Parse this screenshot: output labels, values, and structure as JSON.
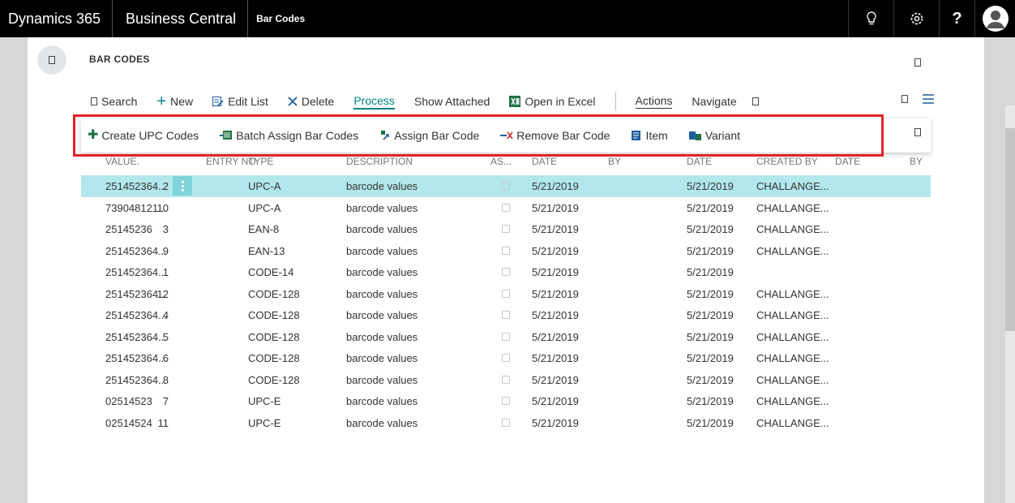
{
  "topbar": {
    "app_name": "Dynamics 365",
    "product_name": "Business Central",
    "page_name": "Bar Codes",
    "icons": [
      "lightbulb-icon",
      "gear-icon",
      "help-icon",
      "user-avatar-icon"
    ],
    "help_label": "?"
  },
  "page": {
    "title": "BAR CODES"
  },
  "actionbar": {
    "search": "Search",
    "new": "New",
    "edit_list": "Edit List",
    "delete": "Delete",
    "process": "Process",
    "show_attached": "Show Attached",
    "open_in_excel": "Open in Excel",
    "actions": "Actions",
    "navigate": "Navigate"
  },
  "submenu": {
    "create_upc": "Create UPC Codes",
    "batch_assign": "Batch Assign Bar Codes",
    "assign": "Assign Bar Code",
    "remove": "Remove Bar Code",
    "item": "Item",
    "variant": "Variant"
  },
  "columns": {
    "value": "VALUE.",
    "entry_no": "ENTRY NO",
    "type": "TYPE",
    "description": "DESCRIPTION",
    "as": "AS...",
    "date": "DATE",
    "by": "BY",
    "date2": "DATE",
    "created_by": "CREATED BY",
    "date3": "DATE",
    "by2": "BY"
  },
  "rows": [
    {
      "value": "251452364...",
      "entry": "2",
      "type": "UPC-A",
      "desc": "barcode values",
      "date": "5/21/2019",
      "date2": "5/21/2019",
      "by": "CHALLANGE..."
    },
    {
      "value": "739048121...",
      "entry": "10",
      "type": "UPC-A",
      "desc": "barcode values",
      "date": "5/21/2019",
      "date2": "5/21/2019",
      "by": "CHALLANGE..."
    },
    {
      "value": "25145236",
      "entry": "3",
      "type": "EAN-8",
      "desc": "barcode values",
      "date": "5/21/2019",
      "date2": "5/21/2019",
      "by": "CHALLANGE..."
    },
    {
      "value": "251452364...",
      "entry": "9",
      "type": "EAN-13",
      "desc": "barcode values",
      "date": "5/21/2019",
      "date2": "5/21/2019",
      "by": "CHALLANGE..."
    },
    {
      "value": "251452364...",
      "entry": "1",
      "type": "CODE-14",
      "desc": "barcode values",
      "date": "5/21/2019",
      "date2": "5/21/2019",
      "by": ""
    },
    {
      "value": "251452364...",
      "entry": "12",
      "type": "CODE-128",
      "desc": "barcode values",
      "date": "5/21/2019",
      "date2": "5/21/2019",
      "by": "CHALLANGE..."
    },
    {
      "value": "251452364...",
      "entry": "4",
      "type": "CODE-128",
      "desc": "barcode values",
      "date": "5/21/2019",
      "date2": "5/21/2019",
      "by": "CHALLANGE..."
    },
    {
      "value": "251452364...",
      "entry": "5",
      "type": "CODE-128",
      "desc": "barcode values",
      "date": "5/21/2019",
      "date2": "5/21/2019",
      "by": "CHALLANGE..."
    },
    {
      "value": "251452364...",
      "entry": "6",
      "type": "CODE-128",
      "desc": "barcode values",
      "date": "5/21/2019",
      "date2": "5/21/2019",
      "by": "CHALLANGE..."
    },
    {
      "value": "251452364...",
      "entry": "8",
      "type": "CODE-128",
      "desc": "barcode values",
      "date": "5/21/2019",
      "date2": "5/21/2019",
      "by": "CHALLANGE..."
    },
    {
      "value": "02514523",
      "entry": "7",
      "type": "UPC-E",
      "desc": "barcode values",
      "date": "5/21/2019",
      "date2": "5/21/2019",
      "by": "CHALLANGE..."
    },
    {
      "value": "02514524",
      "entry": "11",
      "type": "UPC-E",
      "desc": "barcode values",
      "date": "5/21/2019",
      "date2": "5/21/2019",
      "by": "CHALLANGE..."
    }
  ],
  "selected_row_index": 0,
  "colors": {
    "accent": "#00857e",
    "selected_row": "#b2e8ec",
    "highlight_border": "#e4222a",
    "topbar": "#000000"
  }
}
